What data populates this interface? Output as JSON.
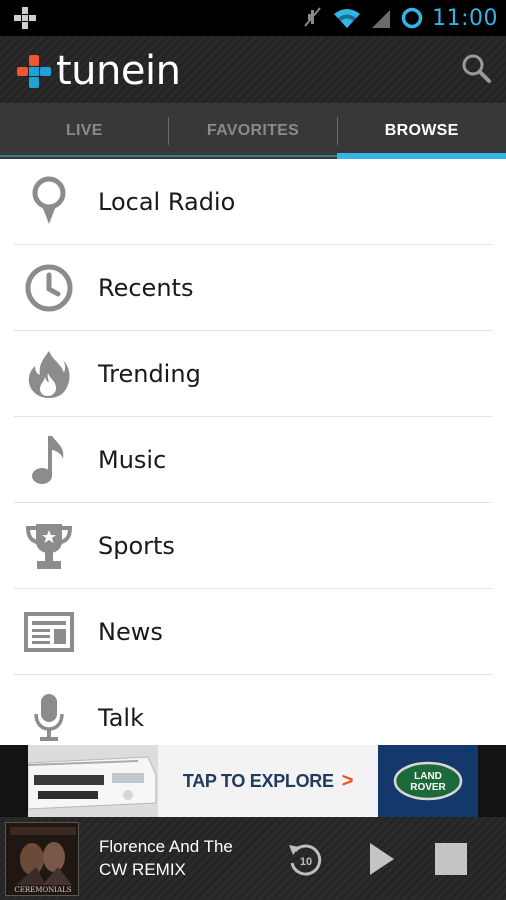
{
  "status_bar": {
    "time": "11:00"
  },
  "app": {
    "logo_text": "tunein"
  },
  "tabs": [
    {
      "label": "LIVE",
      "active": false
    },
    {
      "label": "FAVORITES",
      "active": false
    },
    {
      "label": "BROWSE",
      "active": true
    }
  ],
  "browse_items": [
    {
      "label": "Local Radio",
      "icon": "location-pin-icon"
    },
    {
      "label": "Recents",
      "icon": "clock-icon"
    },
    {
      "label": "Trending",
      "icon": "flame-icon"
    },
    {
      "label": "Music",
      "icon": "music-note-icon"
    },
    {
      "label": "Sports",
      "icon": "trophy-icon"
    },
    {
      "label": "News",
      "icon": "newspaper-icon"
    },
    {
      "label": "Talk",
      "icon": "microphone-icon"
    }
  ],
  "ad": {
    "text": "TAP TO EXPLORE",
    "arrow": ">",
    "brand_line1": "LAND",
    "brand_line2": "ROVER"
  },
  "player": {
    "title": "Florence And The",
    "subtitle": "CW REMIX",
    "rewind_seconds": "10",
    "album_caption": "CEREMONIALS"
  },
  "colors": {
    "accent": "#33b5e5",
    "icon_gray": "#8c8c8c",
    "tunein_orange": "#f0552d",
    "tunein_blue": "#1fa2d8"
  }
}
